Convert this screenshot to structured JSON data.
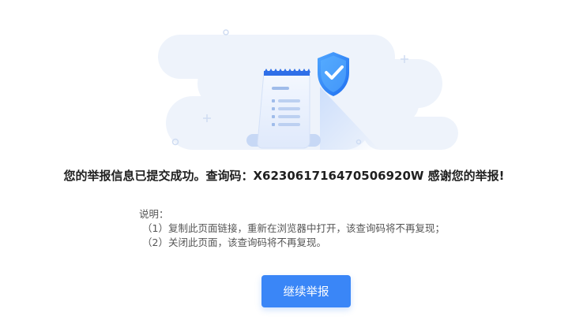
{
  "result": {
    "headline": "您的举报信息已提交成功。查询码：X623061716470506920W 感谢您的举报!"
  },
  "notes": {
    "title": "说明：",
    "items": [
      "（1）复制此页面链接，重新在浏览器中打开，该查询码将不再复现；",
      "（2）关闭此页面，该查询码将不再复现。"
    ]
  },
  "actions": {
    "continue_label": "继续举报"
  },
  "colors": {
    "primary": "#3a86f7",
    "illustration_bg": "#eef3fb",
    "shield": "#2f88ff"
  },
  "icons": {
    "illustration": "document-with-shield-checkmark"
  }
}
